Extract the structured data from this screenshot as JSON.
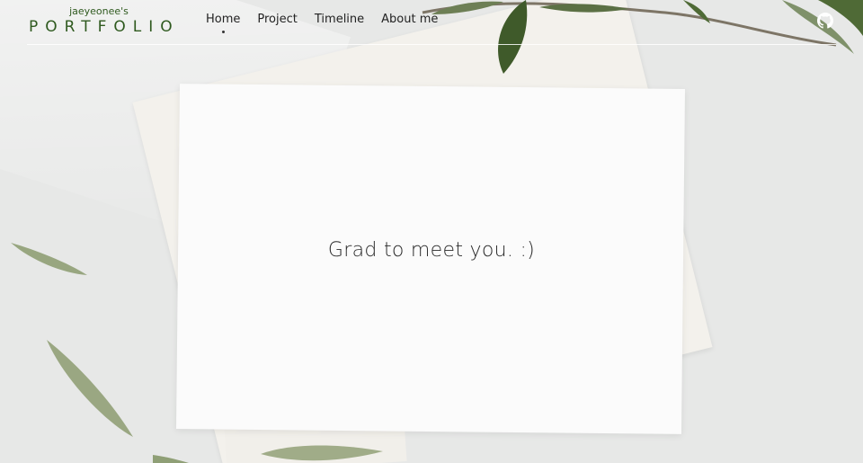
{
  "brand": {
    "owner": "jaeyeonee's",
    "name": "PORTFOLIO",
    "color": "#2f5a1f"
  },
  "nav": {
    "items": [
      {
        "label": "Home",
        "active": true
      },
      {
        "label": "Project",
        "active": false
      },
      {
        "label": "Timeline",
        "active": false
      },
      {
        "label": "About me",
        "active": false
      }
    ]
  },
  "header_icons": {
    "github": "github-icon"
  },
  "hero": {
    "message": "Grad to meet you. :)"
  },
  "colors": {
    "leaf": "#8f9f76",
    "leaf_dark": "#3f5a2a",
    "background": "#e7e8e7"
  }
}
